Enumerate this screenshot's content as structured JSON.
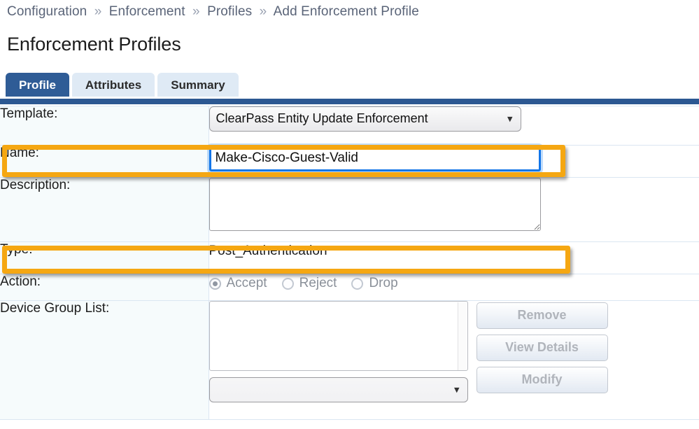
{
  "breadcrumb": {
    "separator": "»",
    "items": [
      "Configuration",
      "Enforcement",
      "Profiles",
      "Add Enforcement Profile"
    ]
  },
  "page_title": "Enforcement Profiles",
  "tabs": [
    {
      "label": "Profile",
      "active": true
    },
    {
      "label": "Attributes",
      "active": false
    },
    {
      "label": "Summary",
      "active": false
    }
  ],
  "form": {
    "template": {
      "label": "Template:",
      "value": "ClearPass Entity Update Enforcement",
      "chevron": "chevron-down-icon"
    },
    "name": {
      "label": "Name:",
      "value": "Make-Cisco-Guest-Valid",
      "placeholder": "",
      "focused": true
    },
    "description": {
      "label": "Description:",
      "value": "",
      "placeholder": ""
    },
    "type": {
      "label": "Type:",
      "value": "Post_Authentication"
    },
    "action": {
      "label": "Action:",
      "options": [
        {
          "label": "Accept",
          "selected": true
        },
        {
          "label": "Reject",
          "selected": false
        },
        {
          "label": "Drop",
          "selected": false
        }
      ],
      "disabled": true
    },
    "device_group_list": {
      "label": "Device Group List:",
      "list_items": [],
      "select_value": "",
      "select_chevron": "chevron-down-icon",
      "buttons": [
        {
          "label": "Remove",
          "disabled": true
        },
        {
          "label": "View Details",
          "disabled": true
        },
        {
          "label": "Modify",
          "disabled": true
        }
      ]
    }
  },
  "highlights": [
    {
      "target": "name-row",
      "color": "#f5a712"
    },
    {
      "target": "type-row",
      "color": "#f5a712"
    }
  ],
  "colors": {
    "tab_active_bg": "#2f5c96",
    "tab_inactive_bg": "#dfeaf5",
    "tabbar_band": "#2c5892",
    "breadcrumb_text": "#5a6478",
    "label_column_bg": "#f6fbfc",
    "row_border": "#dbe6f2",
    "focus_border": "#1476e8",
    "highlight": "#f5a712",
    "disabled_text": "#b0b4bb"
  }
}
